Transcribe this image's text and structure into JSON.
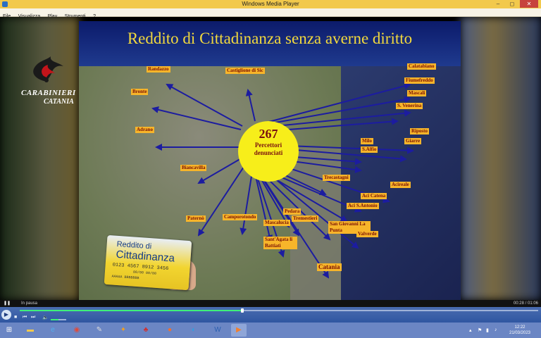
{
  "window": {
    "title": "Windows Media Player",
    "minimize": "–",
    "maximize": "◻",
    "close": "✕"
  },
  "menu": [
    "File",
    "Visualizza",
    "Play",
    "Strumenti",
    "?"
  ],
  "slide": {
    "headline": "Reddito di Cittadinanza senza averne diritto",
    "logo": {
      "line1": "CARABINIERI",
      "line2": "CATANIA"
    },
    "center": {
      "count": "267",
      "label1": "Percettori",
      "label2": "denunciati"
    },
    "towns": [
      {
        "name": "Randazzo"
      },
      {
        "name": "Castiglione di Sic"
      },
      {
        "name": "Calatabiano"
      },
      {
        "name": "Fiumefreddo"
      },
      {
        "name": "Mascali"
      },
      {
        "name": "S. Venerina"
      },
      {
        "name": "Bronte"
      },
      {
        "name": "Adrano"
      },
      {
        "name": "Riposto"
      },
      {
        "name": "Giarre"
      },
      {
        "name": "Milo"
      },
      {
        "name": "S.Alfio"
      },
      {
        "name": "Biancavilla"
      },
      {
        "name": "Trecastagni"
      },
      {
        "name": "Acireale"
      },
      {
        "name": "Aci Catena"
      },
      {
        "name": "Aci S.Antonio"
      },
      {
        "name": "Paternò"
      },
      {
        "name": "Camporotondo"
      },
      {
        "name": "Pedara"
      },
      {
        "name": "Tremestieri"
      },
      {
        "name": "Mascalucia"
      },
      {
        "name": "San Giovanni La Punta"
      },
      {
        "name": "Valverde"
      },
      {
        "name": "Sant'Agata li Battiati"
      },
      {
        "name": "Catania"
      }
    ],
    "card": {
      "line1": "Reddito di",
      "line2": "Cittadinanza",
      "number": "0123 4567 8912 3456",
      "expiry": "00/00   00/00",
      "holder": "AAAAA BBBBBBB"
    }
  },
  "status": {
    "state": "In pausa",
    "time": "00:28 / 01:06"
  },
  "controls": {
    "play": "▶",
    "progress": 0.43,
    "volume": 0.5
  },
  "taskbar": {
    "icons": [
      "windows-start-icon",
      "file-explorer-icon",
      "internet-explorer-icon",
      "chrome-icon",
      "tool-icon",
      "run-icon",
      "game-icon",
      "firefox-icon",
      "media-icon",
      "word-icon",
      "media-player-icon"
    ],
    "clock_time": "12:22",
    "clock_date": "21/03/2023"
  }
}
